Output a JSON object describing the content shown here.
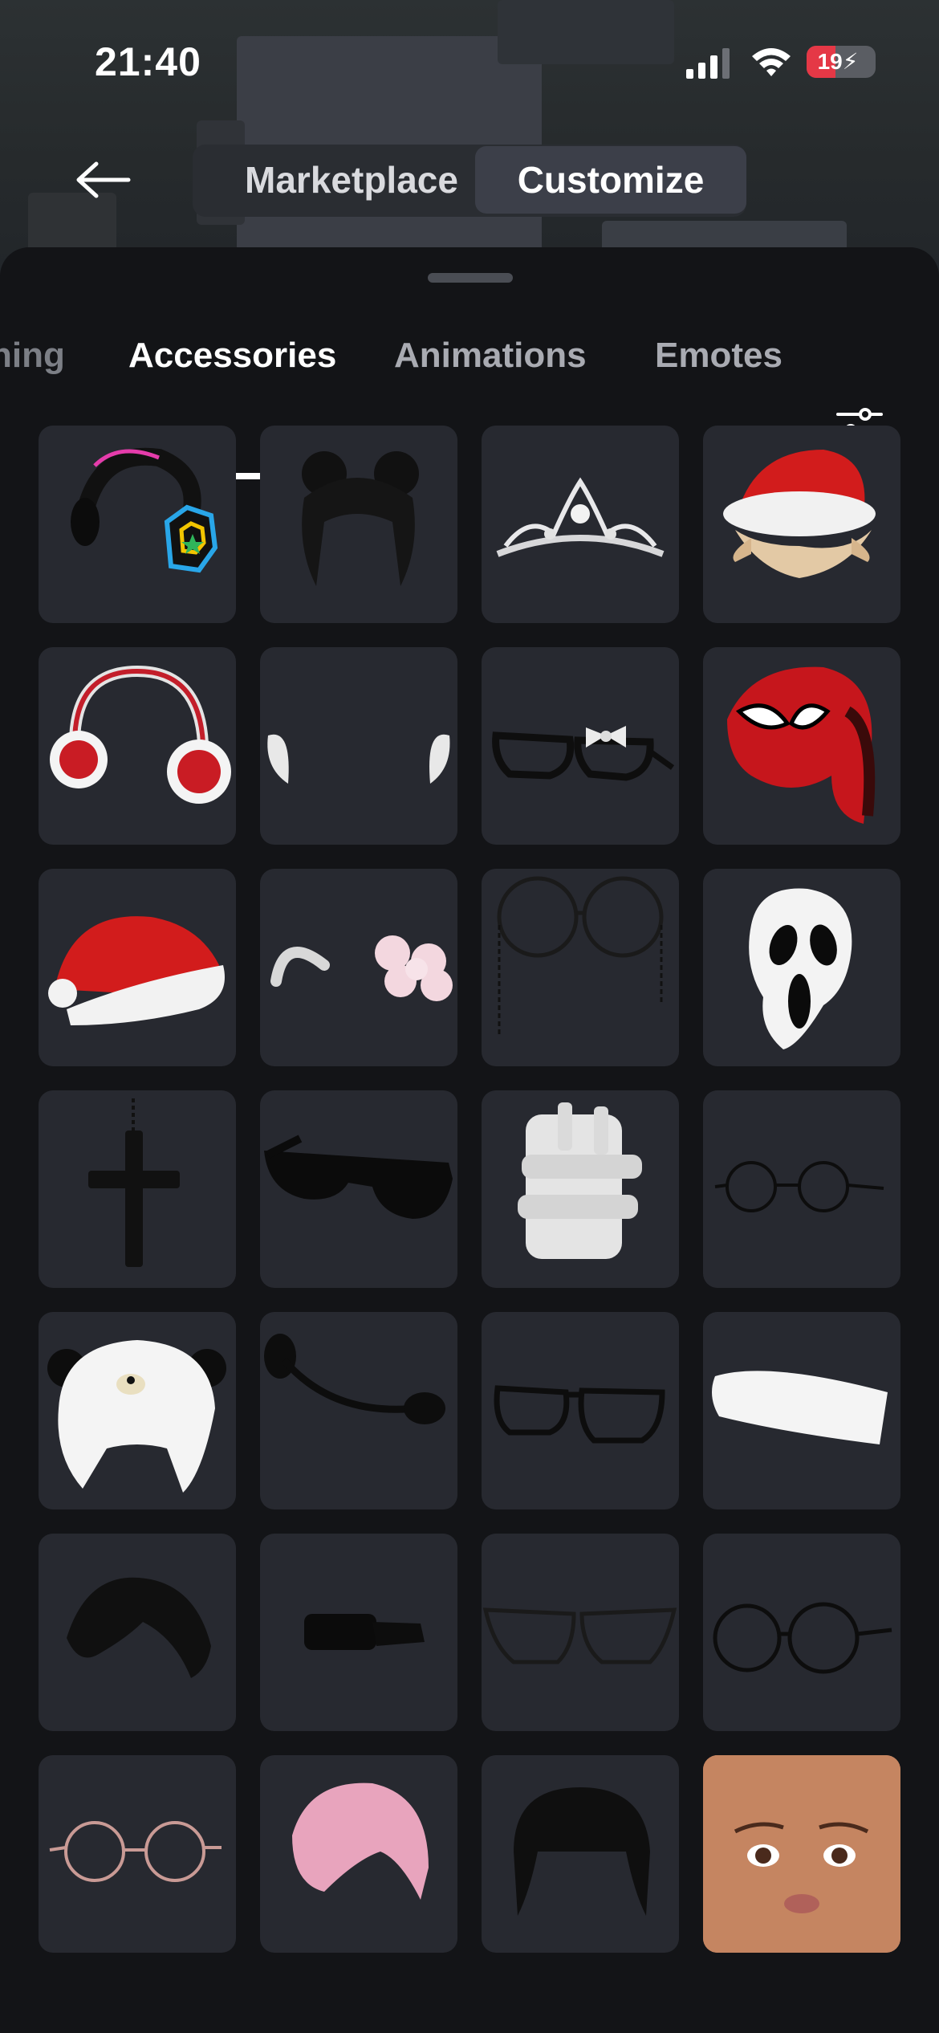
{
  "status_bar": {
    "time": "21:40",
    "battery_level": "19",
    "battery_color": "#e53846",
    "icons": [
      "signal-icon",
      "wifi-icon",
      "battery-charging-icon"
    ]
  },
  "header": {
    "back_icon": "arrow-left-icon",
    "segments": [
      {
        "label": "Marketplace",
        "selected": false
      },
      {
        "label": "Customize",
        "selected": true
      }
    ]
  },
  "tabs": {
    "items": [
      {
        "label": "ning",
        "selected": false
      },
      {
        "label": "Accessories",
        "selected": true
      },
      {
        "label": "Animations",
        "selected": false
      },
      {
        "label": "Emotes",
        "selected": false
      }
    ],
    "filter_icon": "sliders-icon"
  },
  "items": [
    {
      "name": "neon-headphones-item"
    },
    {
      "name": "black-space-buns-hair-item"
    },
    {
      "name": "silver-tiara-item"
    },
    {
      "name": "santa-hat-blonde-hair-item"
    },
    {
      "name": "red-earmuffs-item"
    },
    {
      "name": "white-horns-item"
    },
    {
      "name": "black-glasses-bow-item"
    },
    {
      "name": "spider-hat-item"
    },
    {
      "name": "red-santa-hat-item"
    },
    {
      "name": "cat-ears-pink-bow-item"
    },
    {
      "name": "round-glasses-chain-item"
    },
    {
      "name": "ghost-mask-item"
    },
    {
      "name": "black-cross-necklace-item"
    },
    {
      "name": "black-sunglasses-item"
    },
    {
      "name": "white-bandage-item"
    },
    {
      "name": "thin-round-glasses-item"
    },
    {
      "name": "panda-hat-item"
    },
    {
      "name": "headset-mic-item"
    },
    {
      "name": "black-rectangle-glasses-item"
    },
    {
      "name": "white-headband-item"
    },
    {
      "name": "black-bangs-hair-item"
    },
    {
      "name": "slim-sunglasses-item"
    },
    {
      "name": "black-cat-eye-glasses-item"
    },
    {
      "name": "round-wire-glasses-item"
    },
    {
      "name": "rose-gold-round-glasses-item"
    },
    {
      "name": "pink-bangs-hair-item"
    },
    {
      "name": "black-bob-hair-item"
    },
    {
      "name": "face-makeup-item"
    }
  ]
}
